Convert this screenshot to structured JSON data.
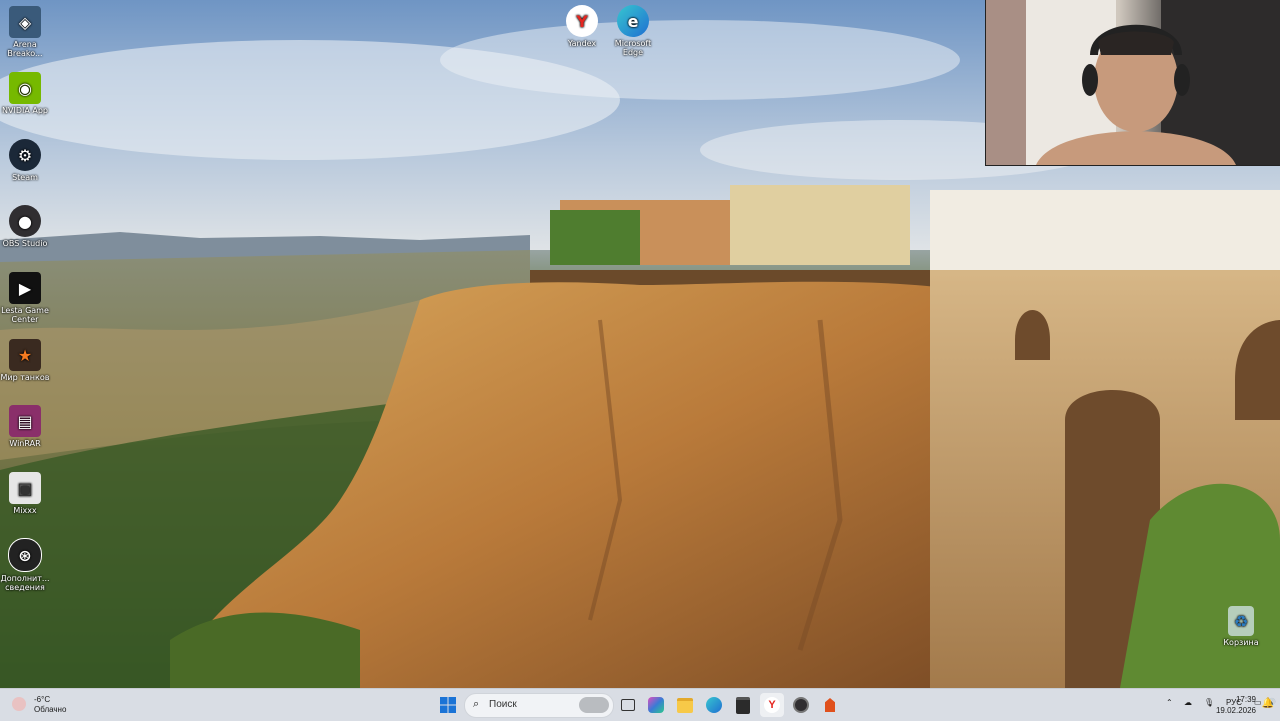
{
  "desktop_icons": [
    {
      "label": "Arena Breako...",
      "icon": "arena-breakout-icon",
      "color": "#3a5a7a"
    },
    {
      "label": "NVIDIA App",
      "icon": "nvidia-icon",
      "color": "#76b900"
    },
    {
      "label": "Steam",
      "icon": "steam-icon",
      "color": "#1b2838"
    },
    {
      "label": "OBS Studio",
      "icon": "obs-icon",
      "color": "#302e31"
    },
    {
      "label": "Lesta Game Center",
      "icon": "lesta-icon",
      "color": "#111111"
    },
    {
      "label": "Мир танков",
      "icon": "mir-tankov-icon",
      "color": "#3a2a20"
    },
    {
      "label": "WinRAR",
      "icon": "winrar-icon",
      "color": "#8a2f6a"
    },
    {
      "label": "Mixxx",
      "icon": "mixxx-icon",
      "color": "#e6e6e6"
    },
    {
      "label": "Дополнит... сведения",
      "icon": "info-icon",
      "color": "#222222"
    }
  ],
  "top_icons": [
    {
      "label": "Yandex",
      "icon": "yandex-browser-icon"
    },
    {
      "label": "Microsoft Edge",
      "icon": "edge-icon"
    }
  ],
  "recycle_bin": {
    "label": "Корзина",
    "icon": "recycle-bin-icon"
  },
  "taskbar": {
    "weather": {
      "temp": "-6°C",
      "condition": "Облачно"
    },
    "search_placeholder": "Поиск",
    "pinned": [
      {
        "name": "start-button",
        "icon": "windows-logo-icon"
      },
      {
        "name": "task-view-button",
        "icon": "task-view-icon"
      },
      {
        "name": "widgets-button",
        "icon": "copilot-icon"
      },
      {
        "name": "file-explorer-button",
        "icon": "folder-icon"
      },
      {
        "name": "edge-button",
        "icon": "edge-icon"
      },
      {
        "name": "store-button",
        "icon": "store-icon"
      },
      {
        "name": "yandex-button",
        "icon": "yandex-browser-icon"
      },
      {
        "name": "obs-button",
        "icon": "obs-icon"
      },
      {
        "name": "lesta-button",
        "icon": "lesta-icon"
      }
    ],
    "tray": {
      "language": "РУС",
      "time": "17:39",
      "date": "19.02.2026"
    }
  }
}
